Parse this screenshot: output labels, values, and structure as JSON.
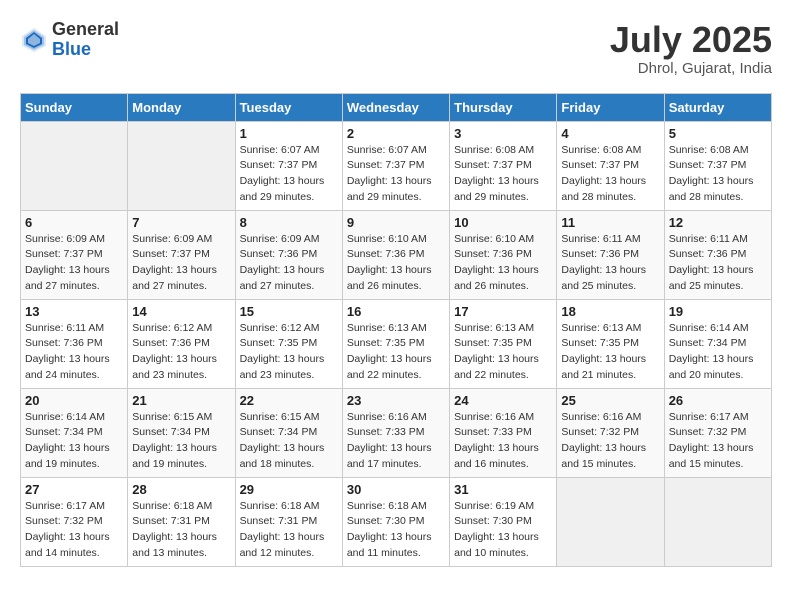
{
  "header": {
    "logo_general": "General",
    "logo_blue": "Blue",
    "month_title": "July 2025",
    "location": "Dhrol, Gujarat, India"
  },
  "weekdays": [
    "Sunday",
    "Monday",
    "Tuesday",
    "Wednesday",
    "Thursday",
    "Friday",
    "Saturday"
  ],
  "weeks": [
    [
      {
        "day": "",
        "sunrise": "",
        "sunset": "",
        "daylight": ""
      },
      {
        "day": "",
        "sunrise": "",
        "sunset": "",
        "daylight": ""
      },
      {
        "day": "1",
        "sunrise": "Sunrise: 6:07 AM",
        "sunset": "Sunset: 7:37 PM",
        "daylight": "Daylight: 13 hours and 29 minutes."
      },
      {
        "day": "2",
        "sunrise": "Sunrise: 6:07 AM",
        "sunset": "Sunset: 7:37 PM",
        "daylight": "Daylight: 13 hours and 29 minutes."
      },
      {
        "day": "3",
        "sunrise": "Sunrise: 6:08 AM",
        "sunset": "Sunset: 7:37 PM",
        "daylight": "Daylight: 13 hours and 29 minutes."
      },
      {
        "day": "4",
        "sunrise": "Sunrise: 6:08 AM",
        "sunset": "Sunset: 7:37 PM",
        "daylight": "Daylight: 13 hours and 28 minutes."
      },
      {
        "day": "5",
        "sunrise": "Sunrise: 6:08 AM",
        "sunset": "Sunset: 7:37 PM",
        "daylight": "Daylight: 13 hours and 28 minutes."
      }
    ],
    [
      {
        "day": "6",
        "sunrise": "Sunrise: 6:09 AM",
        "sunset": "Sunset: 7:37 PM",
        "daylight": "Daylight: 13 hours and 27 minutes."
      },
      {
        "day": "7",
        "sunrise": "Sunrise: 6:09 AM",
        "sunset": "Sunset: 7:37 PM",
        "daylight": "Daylight: 13 hours and 27 minutes."
      },
      {
        "day": "8",
        "sunrise": "Sunrise: 6:09 AM",
        "sunset": "Sunset: 7:36 PM",
        "daylight": "Daylight: 13 hours and 27 minutes."
      },
      {
        "day": "9",
        "sunrise": "Sunrise: 6:10 AM",
        "sunset": "Sunset: 7:36 PM",
        "daylight": "Daylight: 13 hours and 26 minutes."
      },
      {
        "day": "10",
        "sunrise": "Sunrise: 6:10 AM",
        "sunset": "Sunset: 7:36 PM",
        "daylight": "Daylight: 13 hours and 26 minutes."
      },
      {
        "day": "11",
        "sunrise": "Sunrise: 6:11 AM",
        "sunset": "Sunset: 7:36 PM",
        "daylight": "Daylight: 13 hours and 25 minutes."
      },
      {
        "day": "12",
        "sunrise": "Sunrise: 6:11 AM",
        "sunset": "Sunset: 7:36 PM",
        "daylight": "Daylight: 13 hours and 25 minutes."
      }
    ],
    [
      {
        "day": "13",
        "sunrise": "Sunrise: 6:11 AM",
        "sunset": "Sunset: 7:36 PM",
        "daylight": "Daylight: 13 hours and 24 minutes."
      },
      {
        "day": "14",
        "sunrise": "Sunrise: 6:12 AM",
        "sunset": "Sunset: 7:36 PM",
        "daylight": "Daylight: 13 hours and 23 minutes."
      },
      {
        "day": "15",
        "sunrise": "Sunrise: 6:12 AM",
        "sunset": "Sunset: 7:35 PM",
        "daylight": "Daylight: 13 hours and 23 minutes."
      },
      {
        "day": "16",
        "sunrise": "Sunrise: 6:13 AM",
        "sunset": "Sunset: 7:35 PM",
        "daylight": "Daylight: 13 hours and 22 minutes."
      },
      {
        "day": "17",
        "sunrise": "Sunrise: 6:13 AM",
        "sunset": "Sunset: 7:35 PM",
        "daylight": "Daylight: 13 hours and 22 minutes."
      },
      {
        "day": "18",
        "sunrise": "Sunrise: 6:13 AM",
        "sunset": "Sunset: 7:35 PM",
        "daylight": "Daylight: 13 hours and 21 minutes."
      },
      {
        "day": "19",
        "sunrise": "Sunrise: 6:14 AM",
        "sunset": "Sunset: 7:34 PM",
        "daylight": "Daylight: 13 hours and 20 minutes."
      }
    ],
    [
      {
        "day": "20",
        "sunrise": "Sunrise: 6:14 AM",
        "sunset": "Sunset: 7:34 PM",
        "daylight": "Daylight: 13 hours and 19 minutes."
      },
      {
        "day": "21",
        "sunrise": "Sunrise: 6:15 AM",
        "sunset": "Sunset: 7:34 PM",
        "daylight": "Daylight: 13 hours and 19 minutes."
      },
      {
        "day": "22",
        "sunrise": "Sunrise: 6:15 AM",
        "sunset": "Sunset: 7:34 PM",
        "daylight": "Daylight: 13 hours and 18 minutes."
      },
      {
        "day": "23",
        "sunrise": "Sunrise: 6:16 AM",
        "sunset": "Sunset: 7:33 PM",
        "daylight": "Daylight: 13 hours and 17 minutes."
      },
      {
        "day": "24",
        "sunrise": "Sunrise: 6:16 AM",
        "sunset": "Sunset: 7:33 PM",
        "daylight": "Daylight: 13 hours and 16 minutes."
      },
      {
        "day": "25",
        "sunrise": "Sunrise: 6:16 AM",
        "sunset": "Sunset: 7:32 PM",
        "daylight": "Daylight: 13 hours and 15 minutes."
      },
      {
        "day": "26",
        "sunrise": "Sunrise: 6:17 AM",
        "sunset": "Sunset: 7:32 PM",
        "daylight": "Daylight: 13 hours and 15 minutes."
      }
    ],
    [
      {
        "day": "27",
        "sunrise": "Sunrise: 6:17 AM",
        "sunset": "Sunset: 7:32 PM",
        "daylight": "Daylight: 13 hours and 14 minutes."
      },
      {
        "day": "28",
        "sunrise": "Sunrise: 6:18 AM",
        "sunset": "Sunset: 7:31 PM",
        "daylight": "Daylight: 13 hours and 13 minutes."
      },
      {
        "day": "29",
        "sunrise": "Sunrise: 6:18 AM",
        "sunset": "Sunset: 7:31 PM",
        "daylight": "Daylight: 13 hours and 12 minutes."
      },
      {
        "day": "30",
        "sunrise": "Sunrise: 6:18 AM",
        "sunset": "Sunset: 7:30 PM",
        "daylight": "Daylight: 13 hours and 11 minutes."
      },
      {
        "day": "31",
        "sunrise": "Sunrise: 6:19 AM",
        "sunset": "Sunset: 7:30 PM",
        "daylight": "Daylight: 13 hours and 10 minutes."
      },
      {
        "day": "",
        "sunrise": "",
        "sunset": "",
        "daylight": ""
      },
      {
        "day": "",
        "sunrise": "",
        "sunset": "",
        "daylight": ""
      }
    ]
  ]
}
